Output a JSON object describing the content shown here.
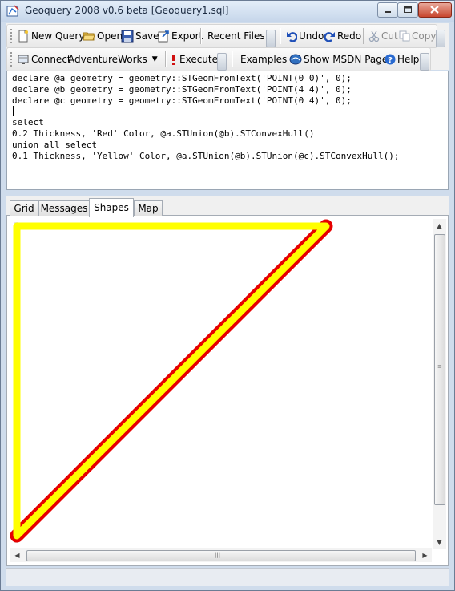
{
  "window": {
    "title": "Geoquery 2008 v0.6 beta [Geoquery1.sql]"
  },
  "toolbar1": {
    "new_query": "New Query",
    "open": "Open",
    "save": "Save",
    "export": "Export",
    "recent_files": "Recent Files",
    "undo": "Undo",
    "redo": "Redo",
    "cut": "Cut",
    "copy": "Copy"
  },
  "toolbar2": {
    "connect": "Connect",
    "database": "AdventureWorks",
    "execute": "Execute",
    "examples": "Examples",
    "msdn": "Show MSDN Page",
    "help": "Help"
  },
  "editor": {
    "lines": [
      "declare @a geometry = geometry::STGeomFromText('POINT(0 0)', 0);",
      "declare @b geometry = geometry::STGeomFromText('POINT(4 4)', 0);",
      "declare @c geometry = geometry::STGeomFromText('POINT(0 4)', 0);",
      "",
      "select",
      "0.2 Thickness, 'Red' Color, @a.STUnion(@b).STConvexHull()",
      "union all select",
      "0.1 Thickness, 'Yellow' Color, @a.STUnion(@b).STUnion(@c).STConvexHull();"
    ]
  },
  "tabs": {
    "grid": "Grid",
    "messages": "Messages",
    "shapes": "Shapes",
    "map": "Map",
    "active": "Shapes"
  },
  "shapes": {
    "red_line": {
      "from": [
        0,
        0
      ],
      "to": [
        4,
        4
      ],
      "color": "#e60000",
      "thickness": 0.2
    },
    "yellow_triangle": {
      "points": [
        [
          0,
          0
        ],
        [
          4,
          4
        ],
        [
          0,
          4
        ]
      ],
      "color": "#ffff00",
      "thickness": 0.1
    }
  },
  "colors": {
    "chrome": "#cfdcec",
    "red": "#e60000",
    "yellow": "#ffff00"
  }
}
